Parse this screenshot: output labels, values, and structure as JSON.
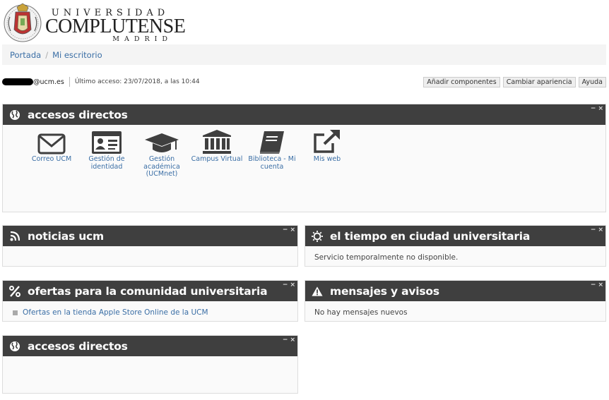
{
  "header": {
    "logo_line1": "UNIVERSIDAD",
    "logo_line2": "COMPLUTENSE",
    "logo_line3": "MADRID"
  },
  "breadcrumb": {
    "items": [
      "Portada",
      "Mi escritorio"
    ],
    "separator": "/"
  },
  "userbar": {
    "email_suffix": "@ucm.es",
    "last_access": "Último acceso: 23/07/2018, a las 10:44",
    "buttons": [
      "Añadir componentes",
      "Cambiar apariencia",
      "Ayuda"
    ]
  },
  "blocks": {
    "accesos1": {
      "title": "accesos directos",
      "icon": "globe-icon",
      "shortcuts": [
        {
          "label": "Correo UCM",
          "icon": "envelope-icon"
        },
        {
          "label": "Gestión de identidad",
          "icon": "id-card-icon"
        },
        {
          "label": "Gestión académica (UCMnet)",
          "icon": "graduation-cap-icon"
        },
        {
          "label": "Campus Virtual",
          "icon": "institution-icon"
        },
        {
          "label": "Biblioteca - Mi cuenta",
          "icon": "book-icon"
        },
        {
          "label": "Mis web",
          "icon": "external-link-icon"
        }
      ]
    },
    "noticias": {
      "title": "noticias ucm",
      "icon": "rss-icon"
    },
    "tiempo": {
      "title": "el tiempo en ciudad universitaria",
      "icon": "sun-icon",
      "message": "Servicio temporalmente no disponible."
    },
    "ofertas": {
      "title": "ofertas para la comunidad universitaria",
      "icon": "percent-icon",
      "link": "Ofertas en la tienda Apple Store Online de la UCM"
    },
    "mensajes": {
      "title": "mensajes y avisos",
      "icon": "warning-icon",
      "message": "No hay mensajes nuevos"
    },
    "accesos2": {
      "title": "accesos directos",
      "icon": "globe-icon"
    }
  },
  "block_controls": {
    "minimize": "−",
    "close": "×"
  },
  "colors": {
    "header_bg": "#3f3f3f",
    "link": "#3a6ea5",
    "breadcrumb_bg": "#f4f4f4"
  }
}
